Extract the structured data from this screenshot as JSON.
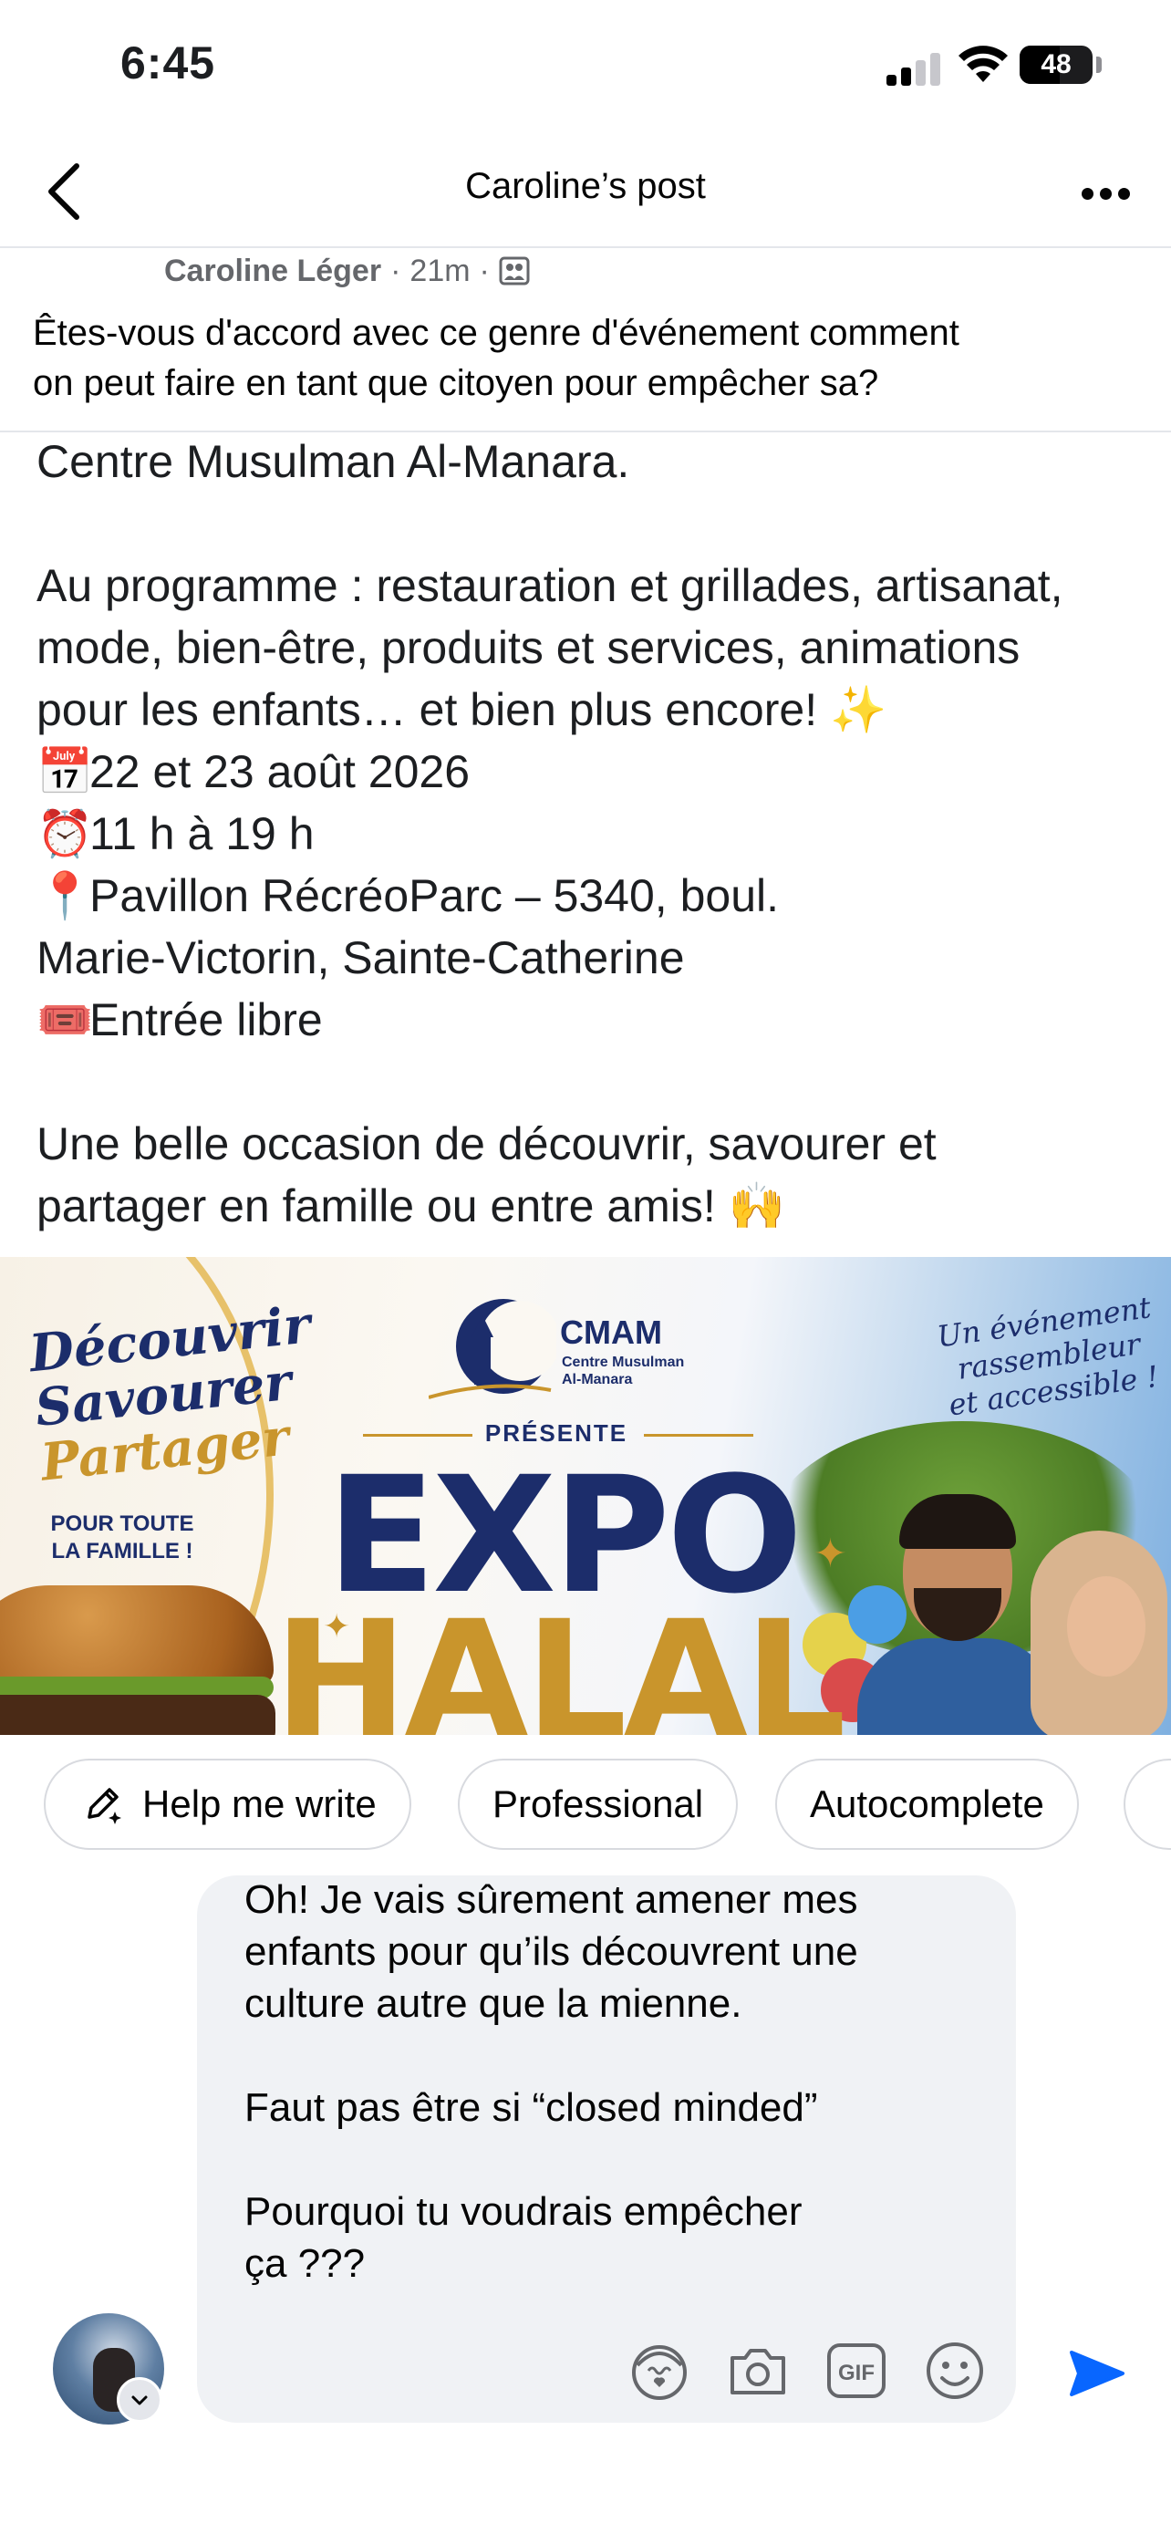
{
  "status_bar": {
    "time": "6:45",
    "battery": "48"
  },
  "nav": {
    "title": "Caroline’s post"
  },
  "post": {
    "author": "Caroline Léger",
    "separator": "·",
    "time_ago": "21m",
    "caption_line1": "Êtes-vous d'accord avec ce genre d'événement comment",
    "caption_line2": "on peut faire en tant que citoyen pour empêcher sa?"
  },
  "screenshot_text": {
    "line1": "Centre Musulman Al-Manara.",
    "line2": "Au programme : restauration et grillades, artisanat,",
    "line3": "mode, bien-être, produits et services, animations",
    "line4": "pour les enfants… et bien plus encore! ✨",
    "date_emoji": "📅",
    "date": "22 et 23 août 2026",
    "time_emoji": "⏰",
    "hours": "11 h à 19 h",
    "place_emoji": "📍",
    "place1": "Pavillon RécréoParc – 5340, boul.",
    "place2": "Marie-Victorin, Sainte-Catherine",
    "ticket_emoji": "🎟️",
    "entry": "Entrée libre",
    "closing1": "Une belle occasion de découvrir, savourer et",
    "closing2": "partager en famille ou entre amis! 🙌"
  },
  "banner": {
    "tag1": "Découvrir",
    "tag2": "Savourer",
    "tag3": "Partager",
    "family1": "POUR TOUTE",
    "family2": "LA FAMILLE !",
    "org_short": "CMAM",
    "org_line1": "Centre Musulman",
    "org_line2": "Al-Manara",
    "presents": "PRÉSENTE",
    "expo": "EXPO",
    "halal": "HALAL",
    "slogan1": "Un événement",
    "slogan2": "rassembleur",
    "slogan3": "et accessible !"
  },
  "ai_chips": [
    {
      "label": "Help me write",
      "icon": "pen-sparkle-icon"
    },
    {
      "label": "Professional"
    },
    {
      "label": "Autocomplete"
    }
  ],
  "composer": {
    "line1": "Oh! Je vais sûrement amener mes",
    "line2": "enfants pour qu’ils découvrent une",
    "line3": "culture autre que la mienne.",
    "line4": "Faut pas être si “closed minded”",
    "line5": "Pourquoi tu voudrais empêcher",
    "line6": "ça ???",
    "tools": [
      "avatar-sticker-icon",
      "camera-icon",
      "gif-icon",
      "emoji-icon"
    ]
  },
  "colors": {
    "accent": "#0866ff",
    "text": "#050505",
    "secondary_text": "#65676b",
    "bubble": "#f0f2f5",
    "navy": "#1c2d6b",
    "gold": "#c9952c"
  }
}
